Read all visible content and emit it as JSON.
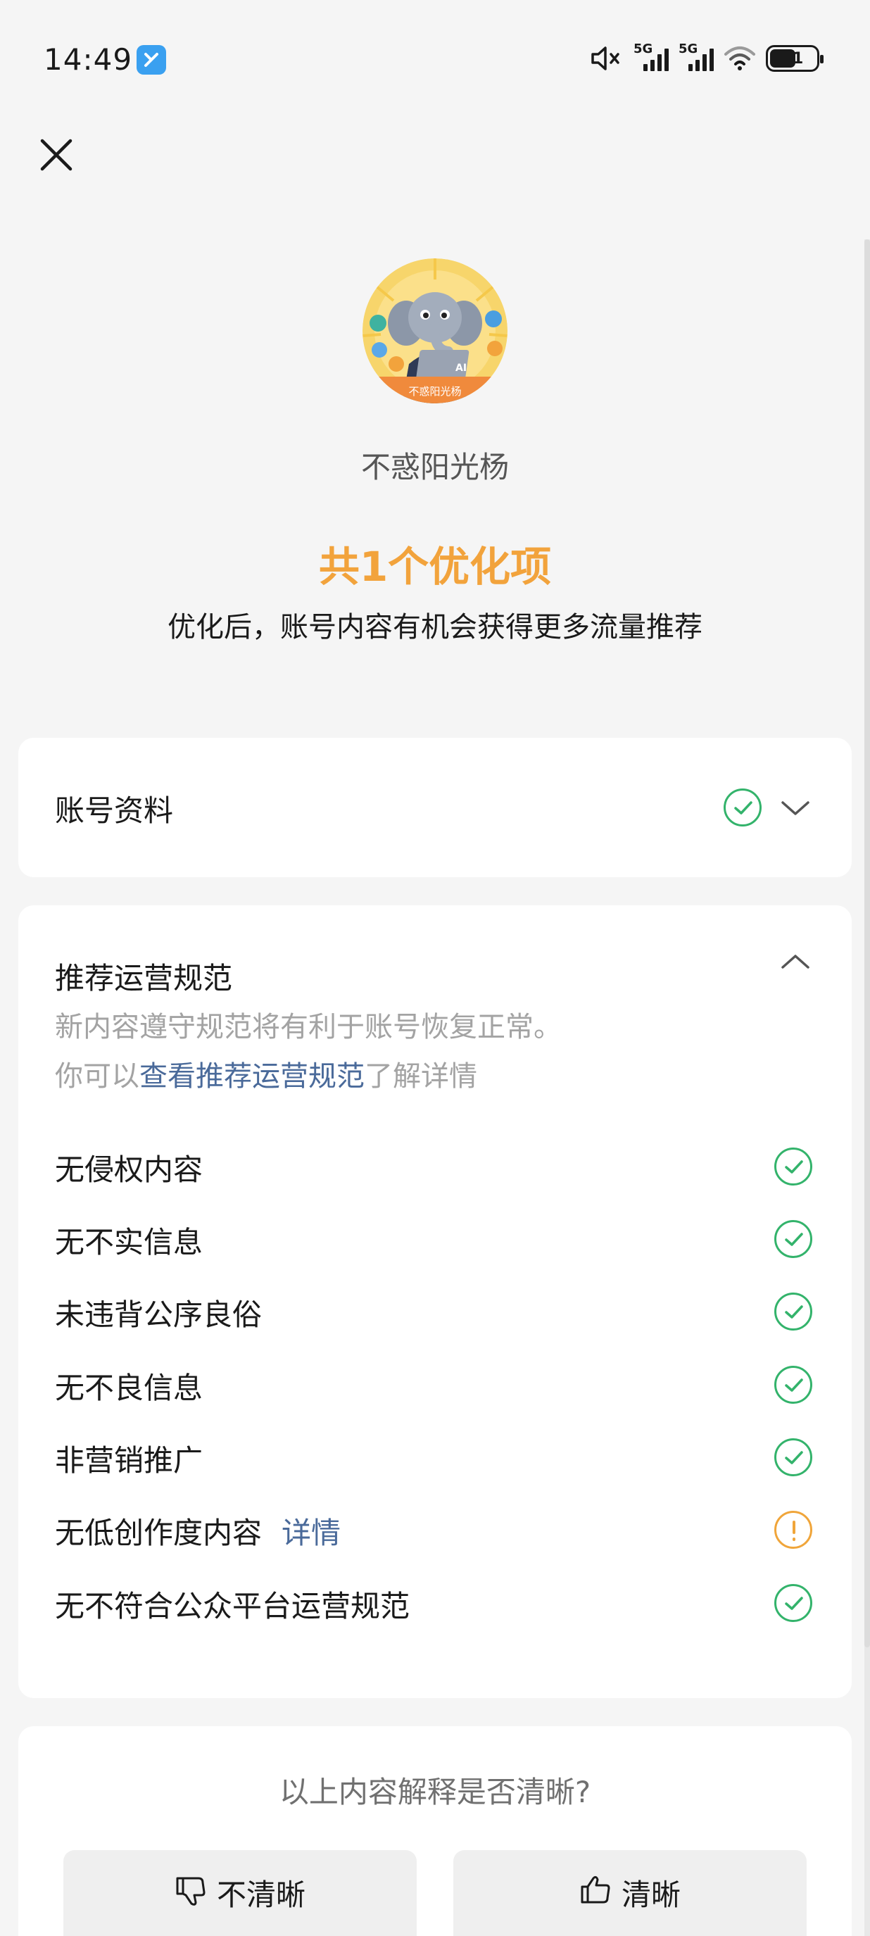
{
  "status_bar": {
    "time": "14:49",
    "net1": "5G",
    "net2": "5G",
    "battery": "51"
  },
  "account": {
    "name": "不惑阳光杨",
    "avatar_caption": "不惑阳光杨",
    "avatar_laptop_text": "AI"
  },
  "summary": {
    "title": "共1个优化项",
    "subtitle": "优化后，账号内容有机会获得更多流量推荐"
  },
  "profile_card": {
    "label": "账号资料",
    "status": "ok"
  },
  "rules_card": {
    "title": "推荐运营规范",
    "desc_line1": "新内容遵守规范将有利于账号恢复正常。",
    "desc_line2_prefix": "你可以",
    "desc_link": "查看推荐运营规范",
    "desc_line2_suffix": "了解详情",
    "items": [
      {
        "label": "无侵权内容",
        "status": "ok",
        "link": ""
      },
      {
        "label": "无不实信息",
        "status": "ok",
        "link": ""
      },
      {
        "label": "未违背公序良俗",
        "status": "ok",
        "link": ""
      },
      {
        "label": "无不良信息",
        "status": "ok",
        "link": ""
      },
      {
        "label": "非营销推广",
        "status": "ok",
        "link": ""
      },
      {
        "label": "无低创作度内容",
        "status": "warning",
        "link": "详情"
      },
      {
        "label": "无不符合公众平台运营规范",
        "status": "ok",
        "link": ""
      }
    ]
  },
  "feedback": {
    "question": "以上内容解释是否清晰?",
    "unclear_label": "不清晰",
    "clear_label": "清晰"
  },
  "colors": {
    "accent_orange": "#f2a33c",
    "check_green": "#33b36b",
    "link_blue": "#4a6a9a"
  },
  "icons": [
    "close-icon",
    "app-badge-icon",
    "mute-icon",
    "signal-icon",
    "wifi-icon",
    "battery-icon",
    "check-circle-icon",
    "warning-circle-icon",
    "chevron-down-icon",
    "chevron-up-icon",
    "thumbs-down-icon",
    "thumbs-up-icon"
  ]
}
